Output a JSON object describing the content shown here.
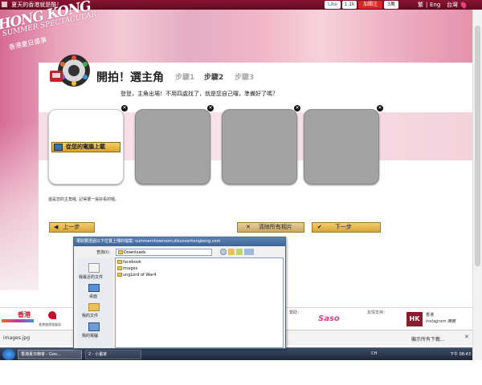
{
  "topbar": {
    "title": "夏天的香港就是酷！",
    "like_label": "Like",
    "like_count": "1.1k",
    "weibo_label": "加關注",
    "weibo_count": "3萬",
    "lang_zh": "繁",
    "lang_en": "Eng",
    "region": "台灣"
  },
  "logo": {
    "line1": "HONG KONG",
    "line2": "SUMMER SPECTACULAR",
    "line3": "香港夏日盛事"
  },
  "steps": {
    "title": "開拍！選主角",
    "step1": "步驟1",
    "step2": "步驟2",
    "step3": "步驟3"
  },
  "instruction": "登登，主角出場！不用四處找了，就是您自己囉，準備好了嗎？",
  "tiles": {
    "upload_label": "從您的電腦上載",
    "remove_glyph": "✕"
  },
  "note": "還是您的主角喔, 記得選一張好看的喔。",
  "buttons": {
    "prev": "上一步",
    "clear": "清除所有相片",
    "next": "下一步"
  },
  "footer": {
    "hk_logo_text": "香港",
    "hk_logo_sub": "香港旅遊發展局",
    "sponsor_label": "贊助：",
    "saso": "Saso",
    "partner_label": "友情支持：",
    "instagram_label": "香港",
    "instagram_sub": "Instagram 團體",
    "download_text": "images.jpg",
    "show_all": "顯示所有下載..."
  },
  "dialog": {
    "title": "選取要透過以下位置上傳的檔案: summerchowroom.discoverhongkong.com",
    "look_in_label": "查詢(I):",
    "look_in_value": "Downloads",
    "places": [
      "我最近的文件",
      "桌面",
      "我的文件",
      "我的電腦"
    ],
    "files": [
      "facebook",
      "images",
      "ungLord of War4"
    ]
  },
  "taskbar": {
    "task1": "香港夏日精會 - Goo...",
    "task2": "2 - 小畫家",
    "time": "下午 08:43",
    "lang": "CH"
  }
}
